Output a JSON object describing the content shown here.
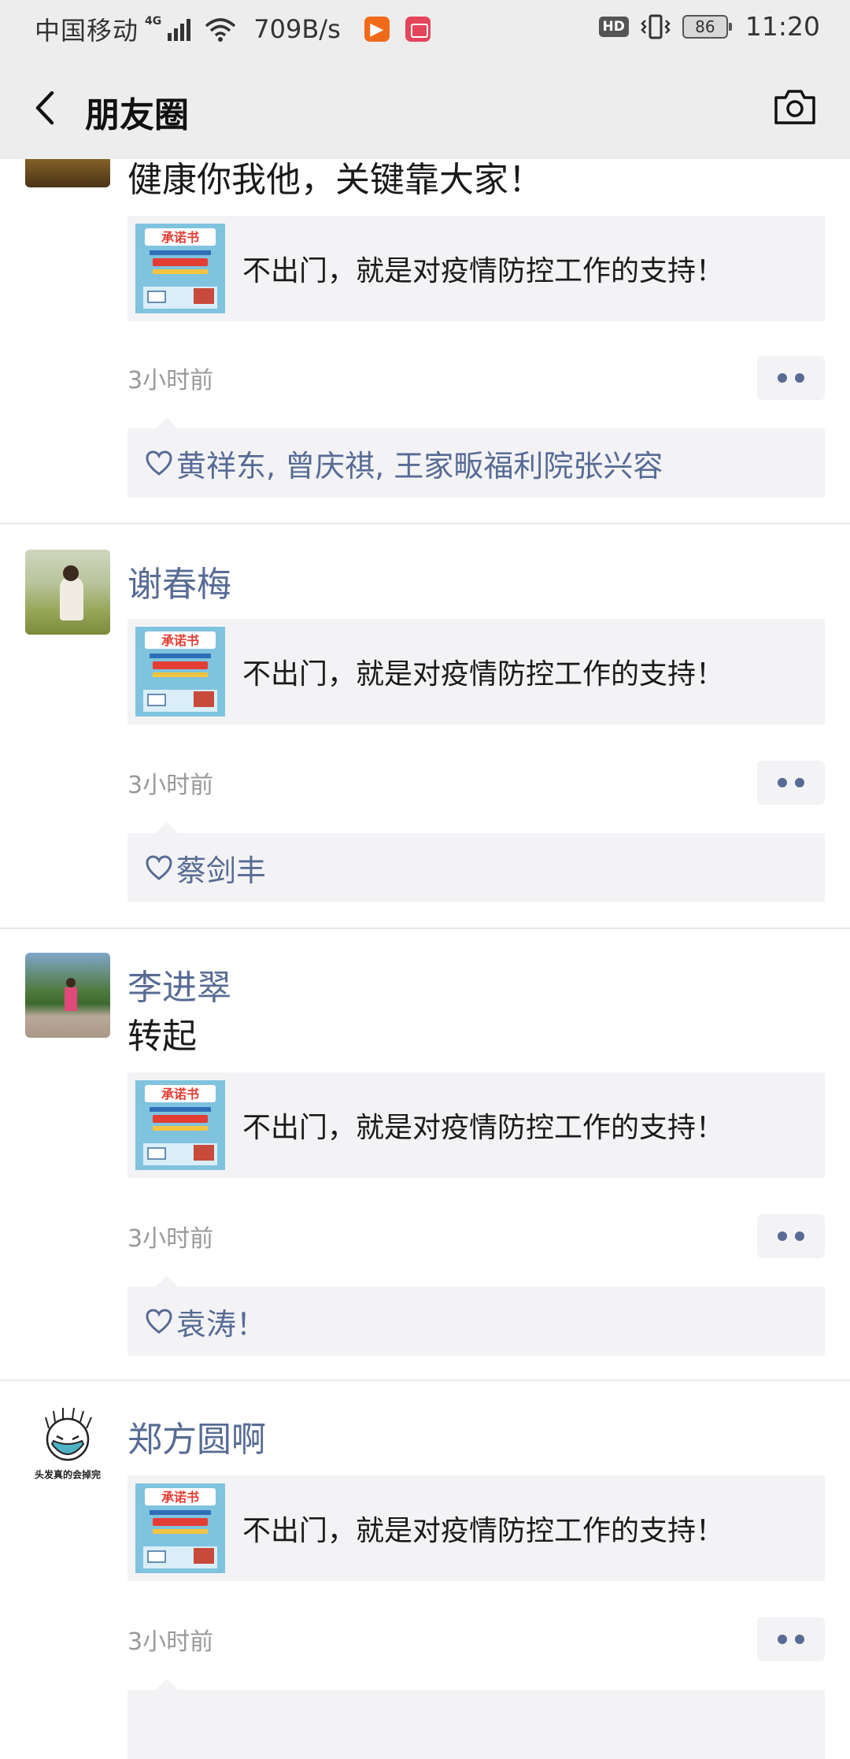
{
  "status_bar": {
    "carrier": "中国移动",
    "network": "4G",
    "speed": "709B/s",
    "hd": "HD",
    "battery": "86",
    "time": "11:20"
  },
  "nav": {
    "title": "朋友圈",
    "back_icon": "back-arrow-icon",
    "camera_icon": "camera-icon"
  },
  "posts": [
    {
      "name": "",
      "text": "健康你我他，关键靠大家！",
      "share_text": "不出门，就是对疫情防控工作的支持！",
      "time": "3小时前",
      "likes": "黄祥东, 曾庆祺, 王家畈福利院张兴容"
    },
    {
      "name": "谢春梅",
      "text": "",
      "share_text": "不出门，就是对疫情防控工作的支持！",
      "time": "3小时前",
      "likes": "蔡剑丰"
    },
    {
      "name": "李进翠",
      "text": "转起",
      "share_text": "不出门，就是对疫情防控工作的支持！",
      "time": "3小时前",
      "likes": "袁涛！"
    },
    {
      "name": "郑方圆啊",
      "avatar_caption": "头发真的会掉完",
      "text": "",
      "share_text": "不出门，就是对疫情防控工作的支持！",
      "time": "3小时前",
      "likes": ""
    }
  ],
  "share_thumb": {
    "title": "承诺书"
  },
  "colors": {
    "link": "#576b95",
    "topbar_bg": "#ededed",
    "card_bg": "#f3f3f5"
  }
}
